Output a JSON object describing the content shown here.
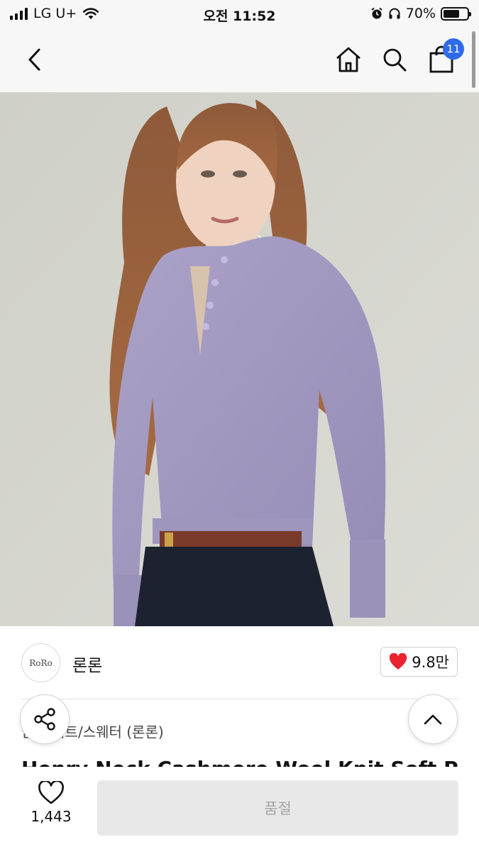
{
  "status_bar": {
    "carrier": "LG U+",
    "time": "오전 11:52",
    "battery_percent": "70%",
    "battery_level": 0.7,
    "icons": [
      "signal-icon",
      "wifi-icon",
      "alarm-icon",
      "headphones-icon",
      "battery-icon"
    ]
  },
  "nav": {
    "icons": [
      "back-icon",
      "home-icon",
      "search-icon",
      "cart-icon"
    ],
    "cart_count": "11"
  },
  "product_image": {
    "icon": "product-photo"
  },
  "seller": {
    "name": "론론",
    "logo_text": "RoRo",
    "likes": "9.8만",
    "like_color": "#e8232f"
  },
  "product": {
    "category": "남성 니트/스웨터 (론론)",
    "title": "Henry Neck Cashmere Wool Knit Soft Pur"
  },
  "bottom": {
    "wish_count": "1,443",
    "action_label": "품절"
  },
  "colors": {
    "accent_blue": "#2f6be8",
    "sweater_lavender": "#a49bc2",
    "disabled_gray": "#e8e8e8"
  }
}
